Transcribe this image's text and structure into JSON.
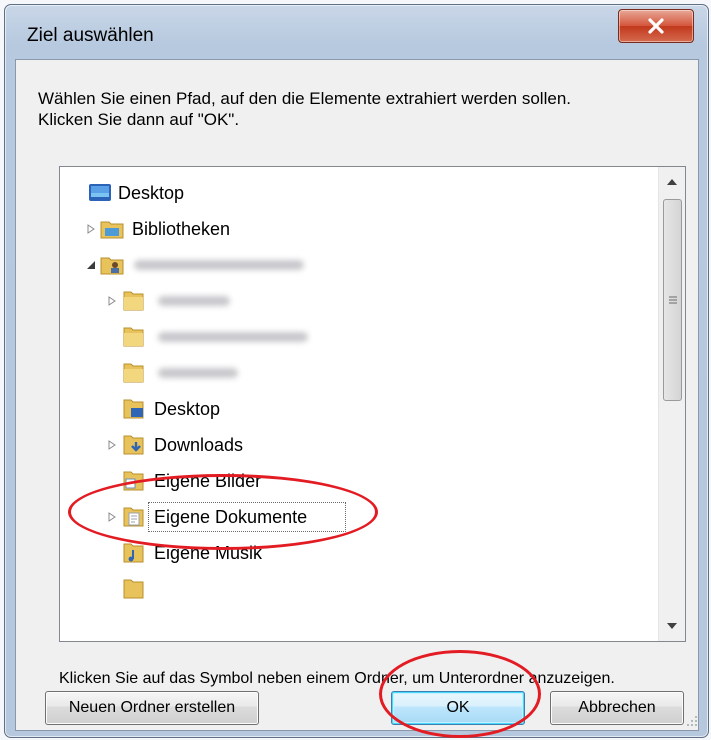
{
  "window": {
    "title": "Ziel auswählen",
    "close_symbol": "✕"
  },
  "dialog": {
    "instruction": "Wählen Sie einen Pfad, auf den die Elemente extrahiert werden sollen.\nKlicken Sie dann auf \"OK\".",
    "hint": "Klicken Sie auf das Symbol neben einem Ordner, um Unterordner anzuzeigen."
  },
  "tree": {
    "items": [
      {
        "label": "Desktop",
        "icon": "desktop-icon",
        "expander": "none"
      },
      {
        "label": "Bibliotheken",
        "icon": "library-icon",
        "expander": "collapsed"
      },
      {
        "label": "",
        "icon": "user-folder-icon",
        "expander": "expanded",
        "blurred": true
      },
      {
        "label": "",
        "icon": "folder-icon",
        "expander": "collapsed",
        "blurred": true
      },
      {
        "label": "",
        "icon": "folder-icon",
        "expander": "none",
        "blurred": true
      },
      {
        "label": "",
        "icon": "folder-icon",
        "expander": "none",
        "blurred": true
      },
      {
        "label": "Desktop",
        "icon": "desktop-folder-icon",
        "expander": "none"
      },
      {
        "label": "Downloads",
        "icon": "downloads-folder-icon",
        "expander": "collapsed"
      },
      {
        "label": "Eigene Bilder",
        "icon": "pictures-folder-icon",
        "expander": "none"
      },
      {
        "label": "Eigene Dokumente",
        "icon": "documents-folder-icon",
        "expander": "collapsed",
        "selected": true
      },
      {
        "label": "Eigene Musik",
        "icon": "music-folder-icon",
        "expander": "none"
      }
    ]
  },
  "buttons": {
    "new_folder": "Neuen Ordner erstellen",
    "ok": "OK",
    "cancel": "Abbrechen"
  },
  "colors": {
    "annotation": "#e31b23",
    "folder": "#e8c25a"
  }
}
